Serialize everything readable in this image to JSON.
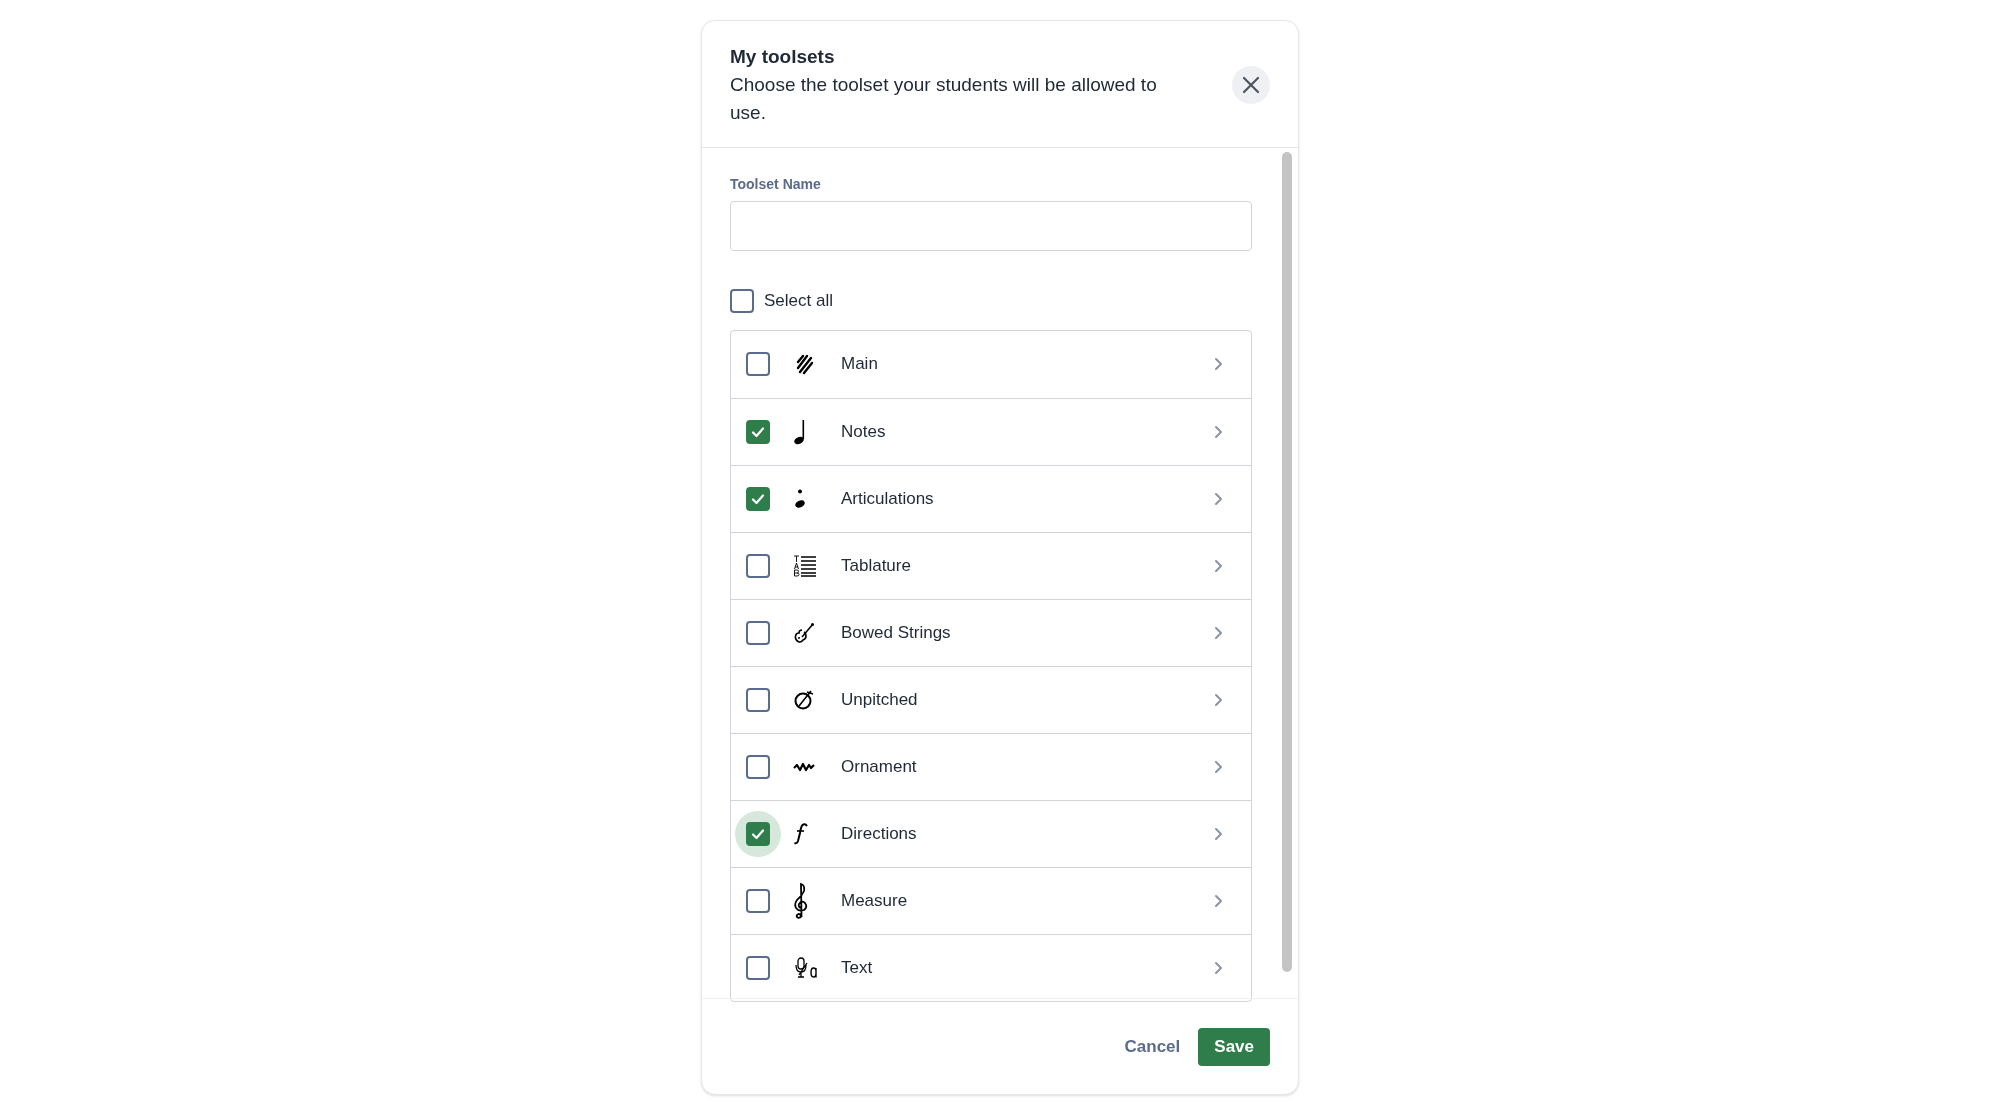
{
  "dialog": {
    "title": "My toolsets",
    "description": "Choose the toolset your students will be allowed to use."
  },
  "toolset_name": {
    "label": "Toolset Name"
  },
  "select_all": {
    "label": "Select all",
    "checked": false
  },
  "toolsets": [
    {
      "kind": "main",
      "label": "Main",
      "checked": false,
      "focused": false
    },
    {
      "kind": "notes",
      "label": "Notes",
      "checked": true,
      "focused": false
    },
    {
      "kind": "articulations",
      "label": "Articulations",
      "checked": true,
      "focused": false
    },
    {
      "kind": "tablature",
      "label": "Tablature",
      "checked": false,
      "focused": false
    },
    {
      "kind": "bowed",
      "label": "Bowed Strings",
      "checked": false,
      "focused": false
    },
    {
      "kind": "unpitched",
      "label": "Unpitched",
      "checked": false,
      "focused": false
    },
    {
      "kind": "ornament",
      "label": "Ornament",
      "checked": false,
      "focused": false
    },
    {
      "kind": "directions",
      "label": "Directions",
      "checked": true,
      "focused": true
    },
    {
      "kind": "measure",
      "label": "Measure",
      "checked": false,
      "focused": false
    },
    {
      "kind": "text",
      "label": "Text",
      "checked": false,
      "focused": false
    }
  ],
  "buttons": {
    "cancel": "Cancel",
    "save": "Save"
  }
}
